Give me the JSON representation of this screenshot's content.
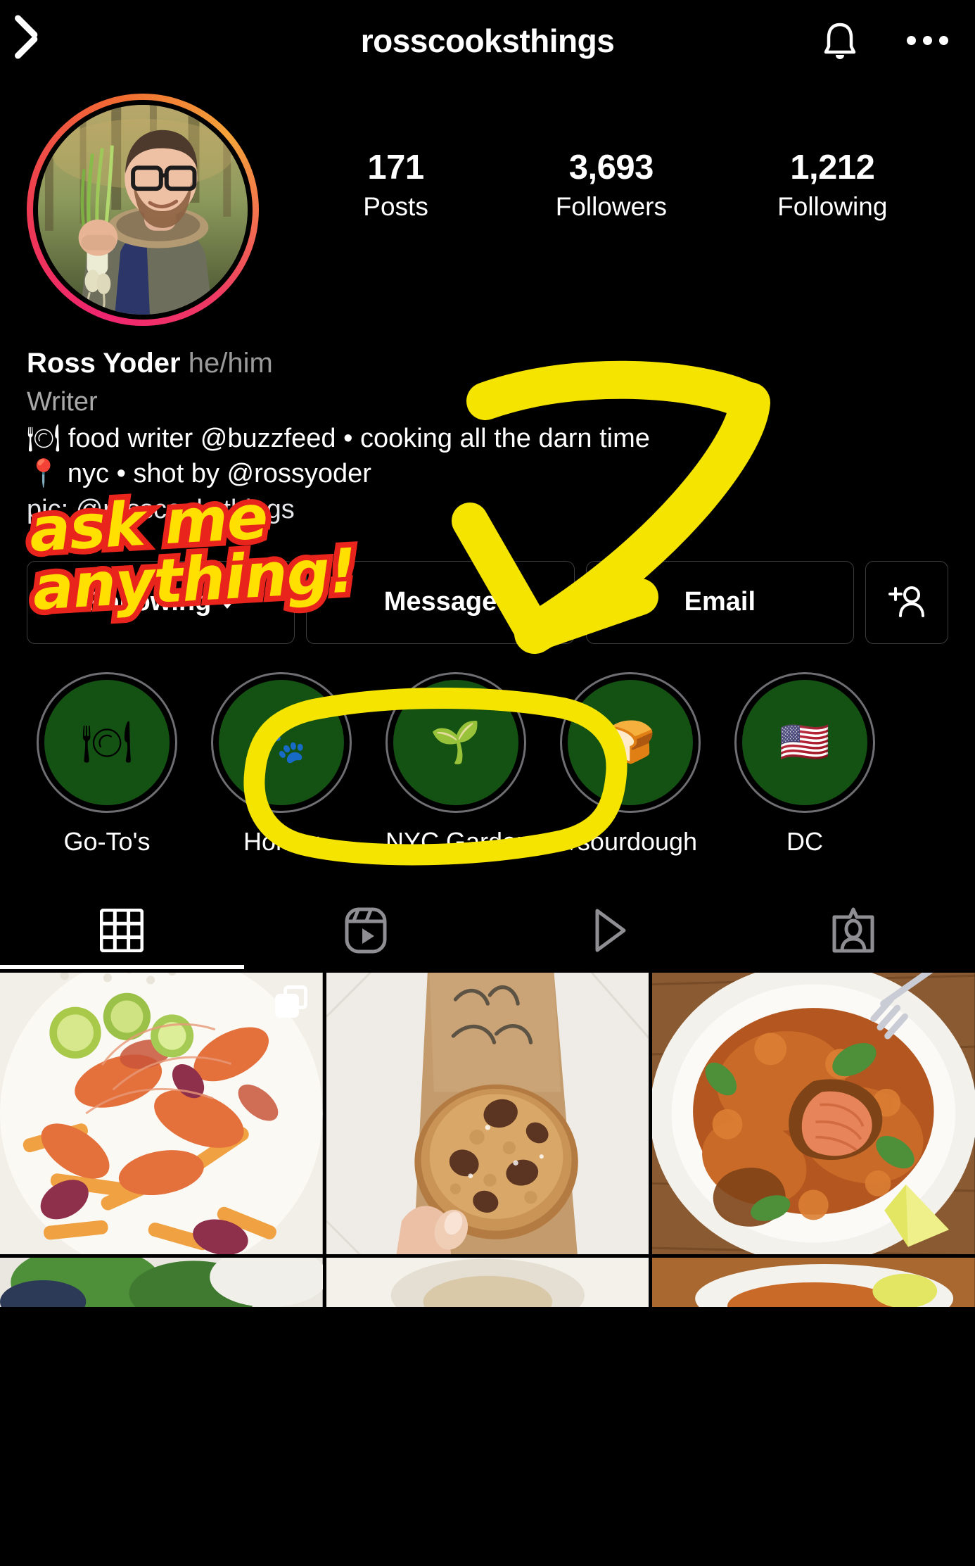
{
  "header": {
    "back_icon": "chevron-left-icon",
    "title": "rosscooksthings",
    "bell_icon": "bell-icon",
    "menu_icon": "more-options-icon"
  },
  "profile": {
    "avatar_alt": "profile-photo",
    "stats": [
      {
        "value": "171",
        "label": "Posts"
      },
      {
        "value": "3,693",
        "label": "Followers"
      },
      {
        "value": "1,212",
        "label": "Following"
      }
    ],
    "display_name": "Ross Yoder",
    "pronouns": "he/him",
    "category": "Writer",
    "bio_lines": [
      "🍽 food writer @buzzfeed • cooking all the darn time",
      "📍 nyc • shot by @rossyoder",
      "pic: @rosscooksthings"
    ]
  },
  "actions": {
    "following_label": "Following",
    "message_label": "Message",
    "email_label": "Email",
    "add_person_icon": "add-person-icon"
  },
  "highlights": [
    {
      "label": "Go-To's",
      "emoji": "🍽",
      "icon_name": "plate-with-cutlery-icon"
    },
    {
      "label": "Homer",
      "emoji": "🐾",
      "icon_name": "paw-prints-icon"
    },
    {
      "label": "NYC Garden",
      "emoji": "🌱",
      "icon_name": "seedling-icon"
    },
    {
      "label": "#sourdough",
      "emoji": "🍞",
      "icon_name": "bread-icon"
    },
    {
      "label": "DC",
      "emoji": "🇺🇸",
      "icon_name": "us-flag-icon"
    }
  ],
  "tabs": [
    {
      "icon_name": "grid-icon",
      "active": true
    },
    {
      "icon_name": "reels-icon",
      "active": false
    },
    {
      "icon_name": "video-play-icon",
      "active": false
    },
    {
      "icon_name": "tagged-photos-icon",
      "active": false
    }
  ],
  "grid": [
    {
      "alt": "seafood-boil-photo",
      "has_carousel": true
    },
    {
      "alt": "chocolate-chip-cookie-photo",
      "has_carousel": false
    },
    {
      "alt": "salmon-dish-photo",
      "has_carousel": false
    }
  ],
  "annotations": {
    "text_line1": "ask me",
    "text_line2": "anything!",
    "text_color": "#ffe000",
    "outline_color": "#e8241c",
    "arrow_color": "#f5e400",
    "circle_color": "#f5e400",
    "circle_target": "message-button"
  }
}
